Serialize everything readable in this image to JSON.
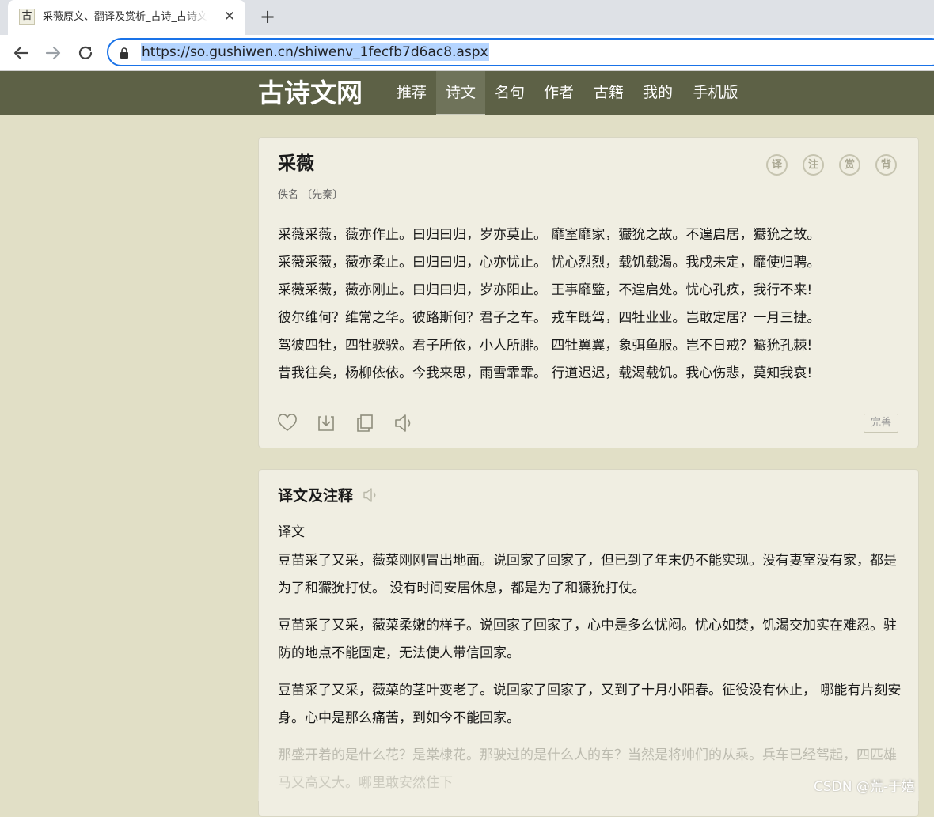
{
  "browser": {
    "tab": {
      "favicon": "古",
      "title": "采薇原文、翻译及赏析_古诗_古诗文网",
      "close": "✕"
    },
    "new_tab": "+",
    "url": "https://so.gushiwen.cn/shiwenv_1fecfb7d6ac8.aspx"
  },
  "site": {
    "logo": "古诗文网",
    "nav": [
      "推荐",
      "诗文",
      "名句",
      "作者",
      "古籍",
      "我的",
      "手机版"
    ],
    "active_nav": "诗文"
  },
  "poem": {
    "title": "采薇",
    "author": "佚名 〔先秦〕",
    "tool_buttons": [
      "译",
      "注",
      "赏",
      "背"
    ],
    "lines": [
      "采薇采薇，薇亦作止。曰归曰归，岁亦莫止。 靡室靡家，玁狁之故。不遑启居，玁狁之故。",
      "采薇采薇，薇亦柔止。曰归曰归，心亦忧止。 忧心烈烈，载饥载渴。我戍未定，靡使归聘。",
      "采薇采薇，薇亦刚止。曰归曰归，岁亦阳止。 王事靡盬，不遑启处。忧心孔疚，我行不来!",
      "彼尔维何？维常之华。彼路斯何？君子之车。 戎车既驾，四牡业业。岂敢定居？一月三捷。",
      "驾彼四牡，四牡骙骙。君子所依，小人所腓。 四牡翼翼，象弭鱼服。岂不日戒？玁狁孔棘!",
      "昔我往矣，杨柳依依。今我来思，雨雪霏霏。 行道迟迟，载渴载饥。我心伤悲，莫知我哀!"
    ],
    "actions": [
      "heart-icon",
      "download-icon",
      "copy-icon",
      "speaker-icon"
    ],
    "improve_label": "完善"
  },
  "translation": {
    "title": "译文及注释",
    "subtitle": "译文",
    "paragraphs": [
      "豆苗采了又采，薇菜刚刚冒出地面。说回家了回家了，但已到了年末仍不能实现。没有妻室没有家，都是为了和玁狁打仗。 没有时间安居休息，都是为了和玁狁打仗。",
      "豆苗采了又采，薇菜柔嫩的样子。说回家了回家了，心中是多么忧闷。忧心如焚，饥渴交加实在难忍。驻防的地点不能固定，无法使人带信回家。",
      "豆苗采了又采，薇菜的茎叶变老了。说回家了回家了，又到了十月小阳春。征役没有休止， 哪能有片刻安身。心中是那么痛苦，到如今不能回家。",
      "那盛开着的是什么花？是棠棣花。那驶过的是什么人的车？当然是将帅们的从乘。兵车已经驾起，四匹雄马又高又大。哪里敢安然住下"
    ]
  },
  "watermark": "CSDN @荒-于嬉",
  "colors": {
    "page_bg": "#e1dfc6",
    "header_bg": "#5d6146",
    "card_bg": "#f0eee2",
    "url_border": "#1a73e8"
  }
}
